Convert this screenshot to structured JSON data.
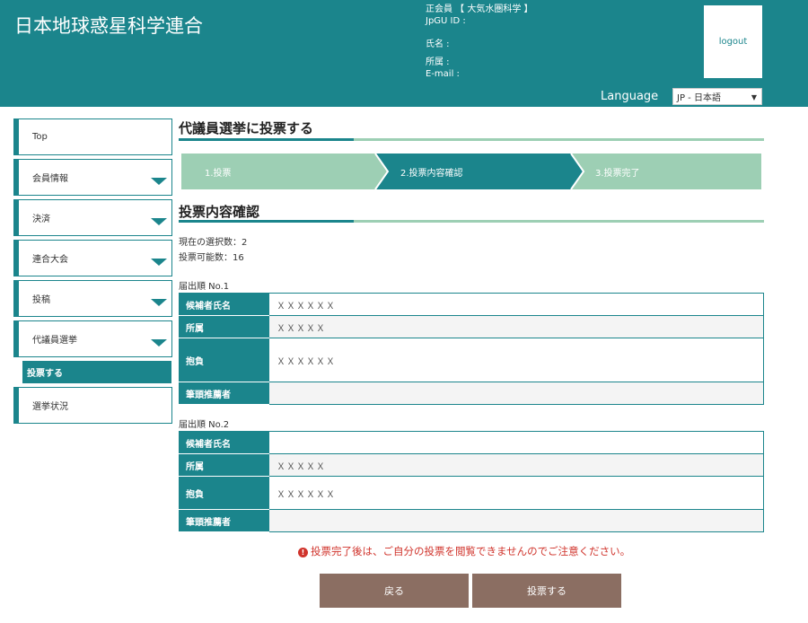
{
  "header": {
    "site_title": "日本地球惑星科学連合",
    "member_type": "正会員 【 大気水圏科学 】",
    "jpgu_id_label": "JpGU ID :",
    "name_label": "氏名 :",
    "affiliation_label": "所属 :",
    "email_label": "E-mail :",
    "logout_label": "logout",
    "language_label": "Language",
    "language_selected": "JP - 日本語"
  },
  "sidebar": {
    "items": [
      {
        "label": "Top",
        "expandable": false
      },
      {
        "label": "会員情報",
        "expandable": true
      },
      {
        "label": "決済",
        "expandable": true
      },
      {
        "label": "連合大会",
        "expandable": true
      },
      {
        "label": "投稿",
        "expandable": true
      },
      {
        "label": "代議員選挙",
        "expandable": true
      }
    ],
    "active_sub": "投票する",
    "after_item": {
      "label": "選挙状況",
      "expandable": false
    }
  },
  "page": {
    "title": "代議員選挙に投票する",
    "section_title": "投票内容確認",
    "steps": [
      "1.投票",
      "2.投票内容確認",
      "3.投票完了"
    ],
    "active_step": 2,
    "current_selection": "現在の選択数：2",
    "votable_count": "投票可能数：16"
  },
  "candidates": [
    {
      "order_label": "届出順 No.1",
      "rows": [
        {
          "label": "候補者氏名",
          "value": "ＸＸＸＸＸＸ"
        },
        {
          "label": "所属",
          "value": " ＸＸＸＸＸ"
        },
        {
          "label": "抱負",
          "value": "ＸＸＸＸＸＸ"
        },
        {
          "label": "筆頭推薦者",
          "value": ""
        }
      ]
    },
    {
      "order_label": "届出順 No.2",
      "rows": [
        {
          "label": "候補者氏名",
          "value": ""
        },
        {
          "label": "所属",
          "value": " ＸＸＸＸＸ"
        },
        {
          "label": "抱負",
          "value": "ＸＸＸＸＸＸ"
        },
        {
          "label": "筆頭推薦者",
          "value": ""
        }
      ]
    }
  ],
  "warning": "投票完了後は、ご自分の投票を閲覧できませんのでご注意ください。",
  "buttons": {
    "back": "戻る",
    "vote": "投票する"
  },
  "colors": {
    "teal": "#1b858c",
    "light_green": "#9dcfb4",
    "button_brown": "#8b6e62",
    "warning_red": "#d0342c"
  }
}
